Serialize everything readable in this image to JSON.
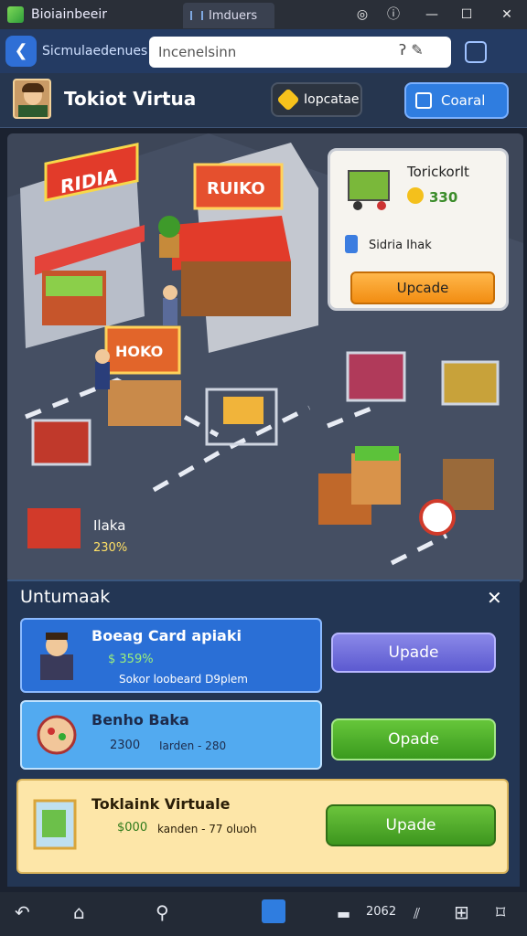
{
  "window": {
    "app_title": "Bioiainbeeir",
    "tab_label": "Imduers"
  },
  "browser": {
    "addr_label": "Sicmulaedenues",
    "addr_value": "Incenelsinn"
  },
  "header": {
    "title": "Tokiot Virtua",
    "pill_primary": "Iopcatae",
    "pill_secondary": "Coaral"
  },
  "board_card": {
    "name": "Torickorlt",
    "value": "330",
    "line": "Sidria Ihak",
    "button": "Upcade"
  },
  "board_item": {
    "label": "Ilaka",
    "value": "230%"
  },
  "panel": {
    "title": "Untumaak",
    "rows": [
      {
        "title": "Boeag Card apiaki",
        "value": "$ 359%",
        "sub": "Sokor loobeard D9plem",
        "button": "Upade"
      },
      {
        "title": "Benho Baka",
        "value": "2300",
        "sub": "Iarden - 280",
        "button": "Opade"
      },
      {
        "title": "Toklaink Virtuale",
        "value": "$000",
        "sub": "kanden - 77 oluoh",
        "button": "Upade"
      }
    ]
  },
  "nav": {
    "status_text": "2062",
    "labels": [
      "back",
      "home",
      "search",
      "tabs",
      "status",
      "qr",
      "bookmark"
    ]
  },
  "colors": {
    "accent": "#2f7de0",
    "upgrade_orange": "#f28d12",
    "upgrade_green": "#3a9a1e",
    "upgrade_purple": "#5c5ad0"
  }
}
